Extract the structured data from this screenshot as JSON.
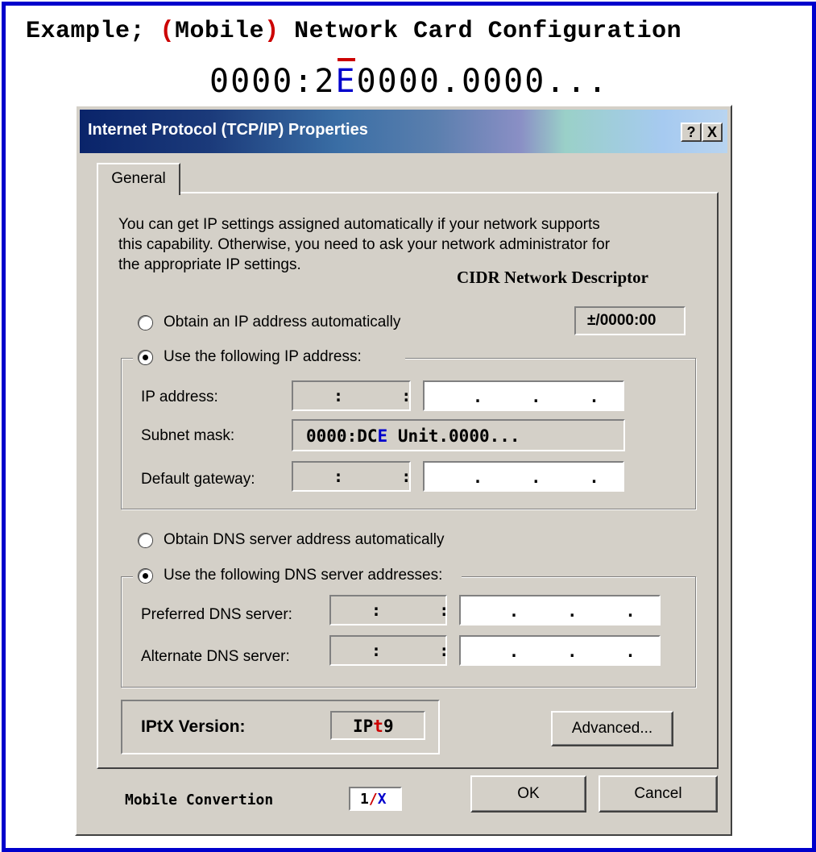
{
  "header": {
    "prefix": "Example; ",
    "paren_open": "(",
    "mobile": "Mobile",
    "paren_close": ")",
    "suffix": " Network Card Configuration",
    "code_pre": "0000:2",
    "code_mark": "E",
    "code_post": "0000.0000..."
  },
  "dialog": {
    "title": "Internet Protocol (TCP/IP) Properties",
    "help_button": "?",
    "close_button": "X",
    "tab_general": "General",
    "intro_line1": "You can get IP settings assigned automatically if your network supports",
    "intro_line2": "this capability. Otherwise, you need to ask your network administrator for",
    "intro_line3": "the appropriate IP settings.",
    "cidr_label": "CIDR Network Descriptor",
    "cidr_value": "±/0000:00",
    "radio_auto_ip": "Obtain an IP address automatically",
    "radio_manual_ip": "Use the following IP address:",
    "ip_address_label": "IP address:",
    "subnet_mask_label": "Subnet mask:",
    "subnet_pre": "0000:DC",
    "subnet_mark": "E",
    "subnet_post": " Unit.0000...",
    "default_gateway_label": "Default gateway:",
    "colon_sep": ":      :",
    "dot_sep": ".     .     .",
    "radio_auto_dns": "Obtain DNS server address automatically",
    "radio_manual_dns": "Use the following DNS server addresses:",
    "preferred_dns_label": "Preferred DNS server:",
    "alternate_dns_label": "Alternate DNS server:",
    "iptx_label": "IPtX Version:",
    "iptx_pre": "IP",
    "iptx_mark": "t",
    "iptx_post": "9",
    "advanced_button": "Advanced...",
    "ok_button": "OK",
    "cancel_button": "Cancel",
    "mobile_conversion_label": "Mobile Convertion",
    "conv_one": "1",
    "conv_slash": "/",
    "conv_x": "X"
  },
  "colors": {
    "frame": "#0000cc",
    "accent_red": "#cc0000",
    "accent_blue": "#0000cc",
    "dialog_face": "#d4d0c8"
  }
}
